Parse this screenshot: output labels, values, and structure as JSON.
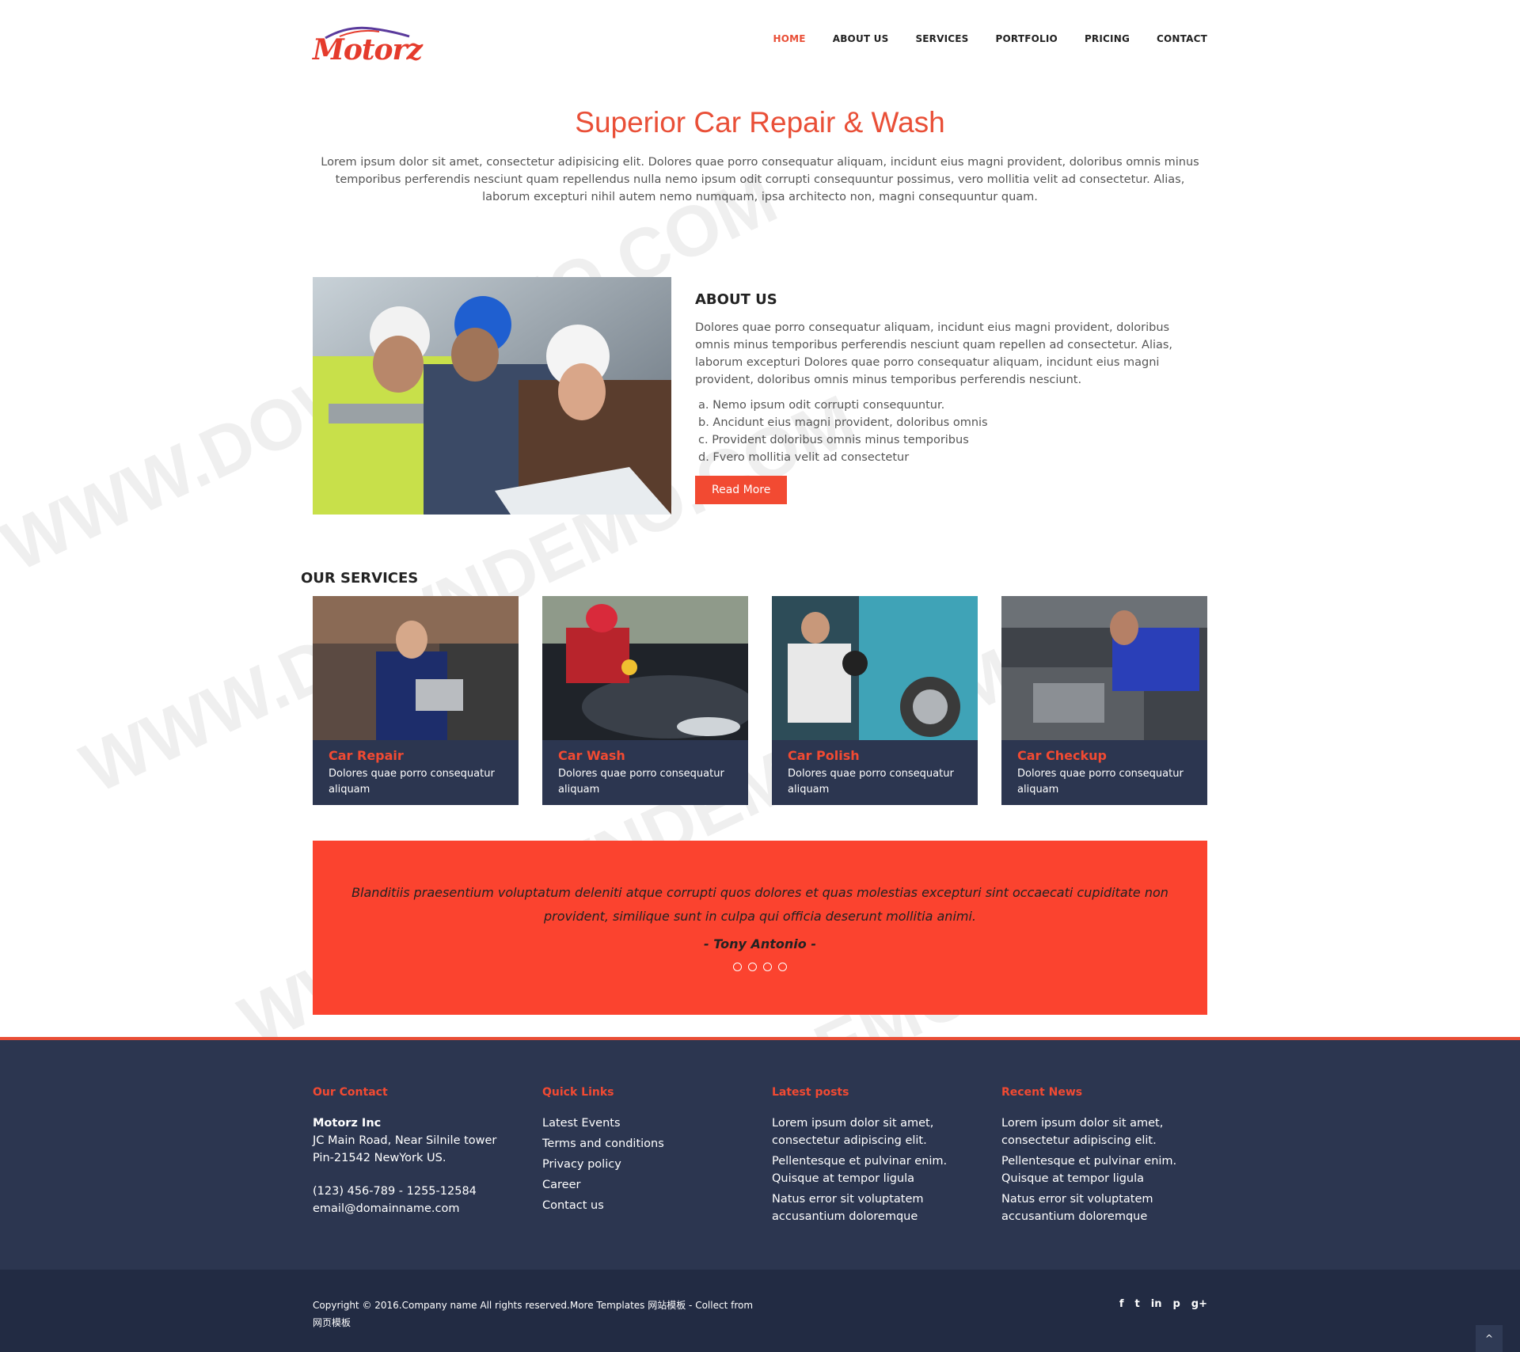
{
  "brand": {
    "logo_text": "Motorz"
  },
  "nav": [
    {
      "label": "HOME"
    },
    {
      "label": "ABOUT US"
    },
    {
      "label": "SERVICES"
    },
    {
      "label": "PORTFOLIO"
    },
    {
      "label": "PRICING"
    },
    {
      "label": "CONTACT"
    }
  ],
  "hero": {
    "title": "Superior Car Repair & Wash",
    "text": "Lorem ipsum dolor sit amet, consectetur adipisicing elit. Dolores quae porro consequatur aliquam, incidunt eius magni provident, doloribus omnis minus temporibus perferendis nesciunt quam repellendus nulla nemo ipsum odit corrupti consequuntur possimus, vero mollitia velit ad consectetur. Alias, laborum excepturi nihil autem nemo numquam, ipsa architecto non, magni consequuntur quam."
  },
  "about": {
    "title": "ABOUT US",
    "text": "Dolores quae porro consequatur aliquam, incidunt eius magni provident, doloribus omnis minus temporibus perferendis nesciunt quam repellen ad consectetur. Alias, laborum excepturi Dolores quae porro consequatur aliquam, incidunt eius magni provident, doloribus omnis minus temporibus perferendis nesciunt.",
    "list": [
      "a. Nemo ipsum odit corrupti consequuntur.",
      "b. Ancidunt eius magni provident, doloribus omnis",
      "c. Provident doloribus omnis minus temporibus",
      "d. Fvero mollitia velit ad consectetur"
    ],
    "button": "Read More"
  },
  "services": {
    "title": "OUR SERVICES",
    "items": [
      {
        "name": "Car Repair",
        "desc": "Dolores quae porro consequatur aliquam"
      },
      {
        "name": "Car Wash",
        "desc": "Dolores quae porro consequatur aliquam"
      },
      {
        "name": "Car Polish",
        "desc": "Dolores quae porro consequatur aliquam"
      },
      {
        "name": "Car Checkup",
        "desc": "Dolores quae porro consequatur aliquam"
      }
    ]
  },
  "testimonial": {
    "quote": "Blanditiis praesentium voluptatum deleniti atque corrupti quos dolores et quas molestias excepturi sint occaecati cupiditate non provident, similique sunt in culpa qui officia deserunt mollitia animi.",
    "author": "- Tony Antonio -"
  },
  "footer": {
    "contact": {
      "title": "Our Contact",
      "company": "Motorz Inc",
      "address1": "JC Main Road, Near Silnile tower",
      "address2": "Pin-21542 NewYork US.",
      "phone": "(123) 456-789 - 1255-12584",
      "email": "email@domainname.com"
    },
    "links": {
      "title": "Quick Links",
      "items": [
        "Latest Events",
        "Terms and conditions",
        "Privacy policy",
        "Career",
        "Contact us"
      ]
    },
    "posts": {
      "title": "Latest posts",
      "items": [
        "Lorem ipsum dolor sit amet, consectetur adipiscing elit.",
        "Pellentesque et pulvinar enim. Quisque at tempor ligula",
        "Natus error sit voluptatem accusantium doloremque"
      ]
    },
    "news": {
      "title": "Recent News",
      "items": [
        "Lorem ipsum dolor sit amet, consectetur adipiscing elit.",
        "Pellentesque et pulvinar enim. Quisque at tempor ligula",
        "Natus error sit voluptatem accusantium doloremque"
      ]
    }
  },
  "bottom": {
    "copyright": "Copyright © 2016.Company name All rights reserved.More Templates 网站模板 - Collect from 网页模板",
    "social": [
      "f",
      "t",
      "in",
      "p",
      "g+"
    ],
    "to_top": "^"
  },
  "watermark": "WWW.DOWNDEMO.COM",
  "colors": {
    "accent": "#f24a32",
    "dark": "#2c3650",
    "darker": "#222b43"
  }
}
